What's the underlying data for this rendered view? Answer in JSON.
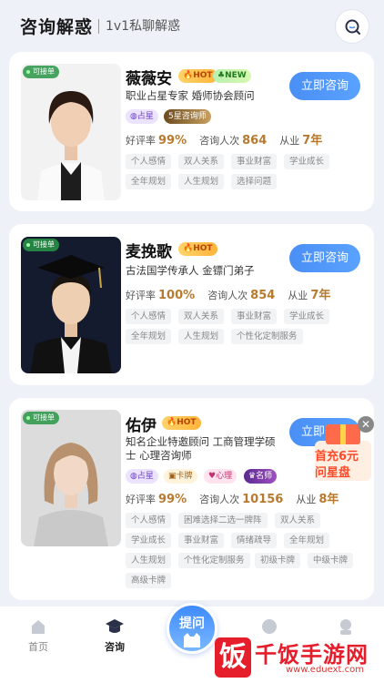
{
  "header": {
    "title": "咨询解惑",
    "subtitle": "1v1私聊解惑"
  },
  "badges_text": {
    "hot": "HOT",
    "new": "NEW",
    "star": "占星",
    "cert": "5星咨询师",
    "card": "卡牌",
    "psy": "心理",
    "fam": "名师"
  },
  "stat_labels": {
    "rating": "好评率",
    "count": "咨询人次",
    "years": "从业"
  },
  "consult_label": "立即咨询",
  "available_label": "可接单",
  "consultants": [
    {
      "name": "薇薇安",
      "desc": "职业占星专家  婚师协会顾问",
      "rating": "99%",
      "count": "864",
      "years": "7年",
      "tags": [
        "个人感情",
        "双人关系",
        "事业财富",
        "学业成长",
        "全年规划",
        "人生规划",
        "选择问题"
      ]
    },
    {
      "name": "麦挽歌",
      "desc": "古法国学传承人  金镖门弟子",
      "rating": "100%",
      "count": "854",
      "years": "7年",
      "tags": [
        "个人感情",
        "双人关系",
        "事业财富",
        "学业成长",
        "全年规划",
        "人生规划",
        "个性化定制服务"
      ]
    },
    {
      "name": "佑伊",
      "desc": "知名企业特邀顾问 工商管理学硕士 心理咨询师",
      "rating": "99%",
      "count": "10156",
      "years": "8年",
      "tags": [
        "个人感情",
        "困难选择二选一牌阵",
        "双人关系",
        "学业成长",
        "事业财富",
        "情绪疏导",
        "全年规划",
        "人生规划",
        "个性化定制服务",
        "初级卡牌",
        "中级卡牌",
        "高级卡牌"
      ]
    }
  ],
  "promo": {
    "line1": "首充6元",
    "line2": "问星盘"
  },
  "tabbar": {
    "home": "首页",
    "consult": "咨询",
    "ask": "提问"
  },
  "watermark": {
    "logo": "饭",
    "text": "千饭手游网",
    "url": "www.eduext.com"
  }
}
